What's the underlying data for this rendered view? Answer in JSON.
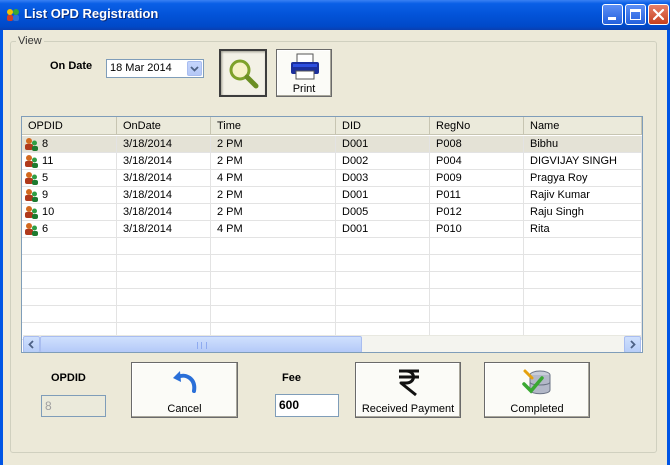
{
  "window": {
    "title": "List OPD  Registration"
  },
  "view": {
    "legend": "View",
    "on_date_label": "On Date",
    "date_value": "18 Mar 2014",
    "print_label": "Print"
  },
  "grid": {
    "columns": [
      "OPDID",
      "OnDate",
      "Time",
      "DID",
      "RegNo",
      "Name"
    ],
    "rows": [
      [
        "8",
        "3/18/2014",
        "2 PM",
        "D001",
        "P008",
        "Bibhu"
      ],
      [
        "11",
        "3/18/2014",
        "2 PM",
        "D002",
        "P004",
        "DIGVIJAY SINGH"
      ],
      [
        "5",
        "3/18/2014",
        "4 PM",
        "D003",
        "P009",
        "Pragya Roy"
      ],
      [
        "9",
        "3/18/2014",
        "2 PM",
        "D001",
        "P011",
        "Rajiv Kumar"
      ],
      [
        "10",
        "3/18/2014",
        "2 PM",
        "D005",
        "P012",
        "Raju Singh"
      ],
      [
        "6",
        "3/18/2014",
        "4 PM",
        "D001",
        "P010",
        "Rita"
      ]
    ],
    "selected_row": 0
  },
  "bottom": {
    "opdid_label": "OPDID",
    "opdid_value": "8",
    "cancel_label": "Cancel",
    "fee_label": "Fee",
    "fee_value": "600",
    "received_label": "Received Payment",
    "completed_label": "Completed"
  },
  "colors": {
    "titlebar": "#0353d8",
    "form_bg": "#ece9d8",
    "selected_row": "#e4e2d6"
  },
  "icons": {
    "app": "app-users-icon",
    "search": "magnifier-icon",
    "print": "printer-icon",
    "cancel": "undo-arrow-icon",
    "received": "rupee-icon",
    "completed": "database-check-icon",
    "row": "user-record-icon"
  }
}
